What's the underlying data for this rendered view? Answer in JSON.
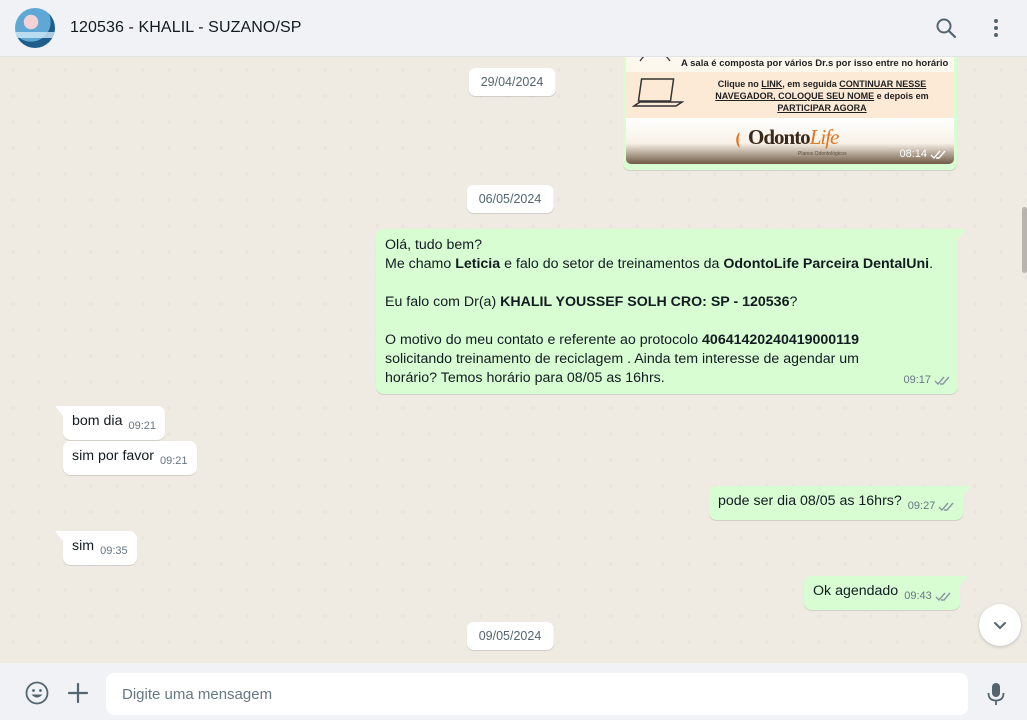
{
  "header": {
    "contact_name": "120536 - KHALIL - SUZANO/SP"
  },
  "icons": {
    "search": "search-icon",
    "menu": "menu-icon",
    "emoji": "emoji-icon",
    "attach": "plus-icon",
    "mic": "mic-icon",
    "scroll_down": "chevron-down-icon"
  },
  "colors": {
    "outgoing_bubble": "#d9fdd3",
    "incoming_bubble": "#ffffff",
    "chat_bg": "#efeae2",
    "read_tick": "#8696a0"
  },
  "image_message": {
    "line1": "A sala é composta por vários Dr.s por isso entre no horário",
    "line2_prefix": "Clique no ",
    "line2_link": "LINK",
    "line2_mid": ", em seguida ",
    "line2_cont": "CONTINUAR NESSE NAVEGADOR, COLOQUE SEU NOME",
    "line2_and": " e depois em ",
    "line2_part": "PARTICIPAR AGORA",
    "logo_main": "Odonto",
    "logo_accent": "Life",
    "logo_sub": "Planos Odontológicos",
    "time": "08:14"
  },
  "dates": {
    "d1": "29/04/2024",
    "d2": "06/05/2024",
    "d3": "09/05/2024"
  },
  "messages": {
    "big": {
      "l1": "Olá, tudo bem?",
      "l2a": "Me chamo ",
      "l2b": "Leticia",
      "l2c": " e falo do setor de treinamentos  da ",
      "l2d": "OdontoLife Parceira DentalUni",
      "l2e": ".",
      "l3a": " Eu falo com Dr(a) ",
      "l3b": "KHALIL YOUSSEF SOLH CRO: SP - 120536",
      "l3c": "?",
      "l4a": "O motivo do meu contato e referente ao protocolo ",
      "l4b": "40641420240419000119",
      "l4c": " solicitando treinamento de reciclagem . Ainda tem interesse de agendar um horário? Temos horário para 08/05 as 16hrs.",
      "time": "09:17"
    },
    "bom_dia": {
      "text": "bom dia",
      "time": "09:21"
    },
    "sim_por_favor": {
      "text": "sim por favor",
      "time": "09:21"
    },
    "pode_ser": {
      "text": "pode ser dia 08/05 as 16hrs?",
      "time": "09:27"
    },
    "sim": {
      "text": "sim",
      "time": "09:35"
    },
    "ok": {
      "text": "Ok agendado",
      "time": "09:43"
    }
  },
  "composer": {
    "placeholder": "Digite uma mensagem"
  }
}
